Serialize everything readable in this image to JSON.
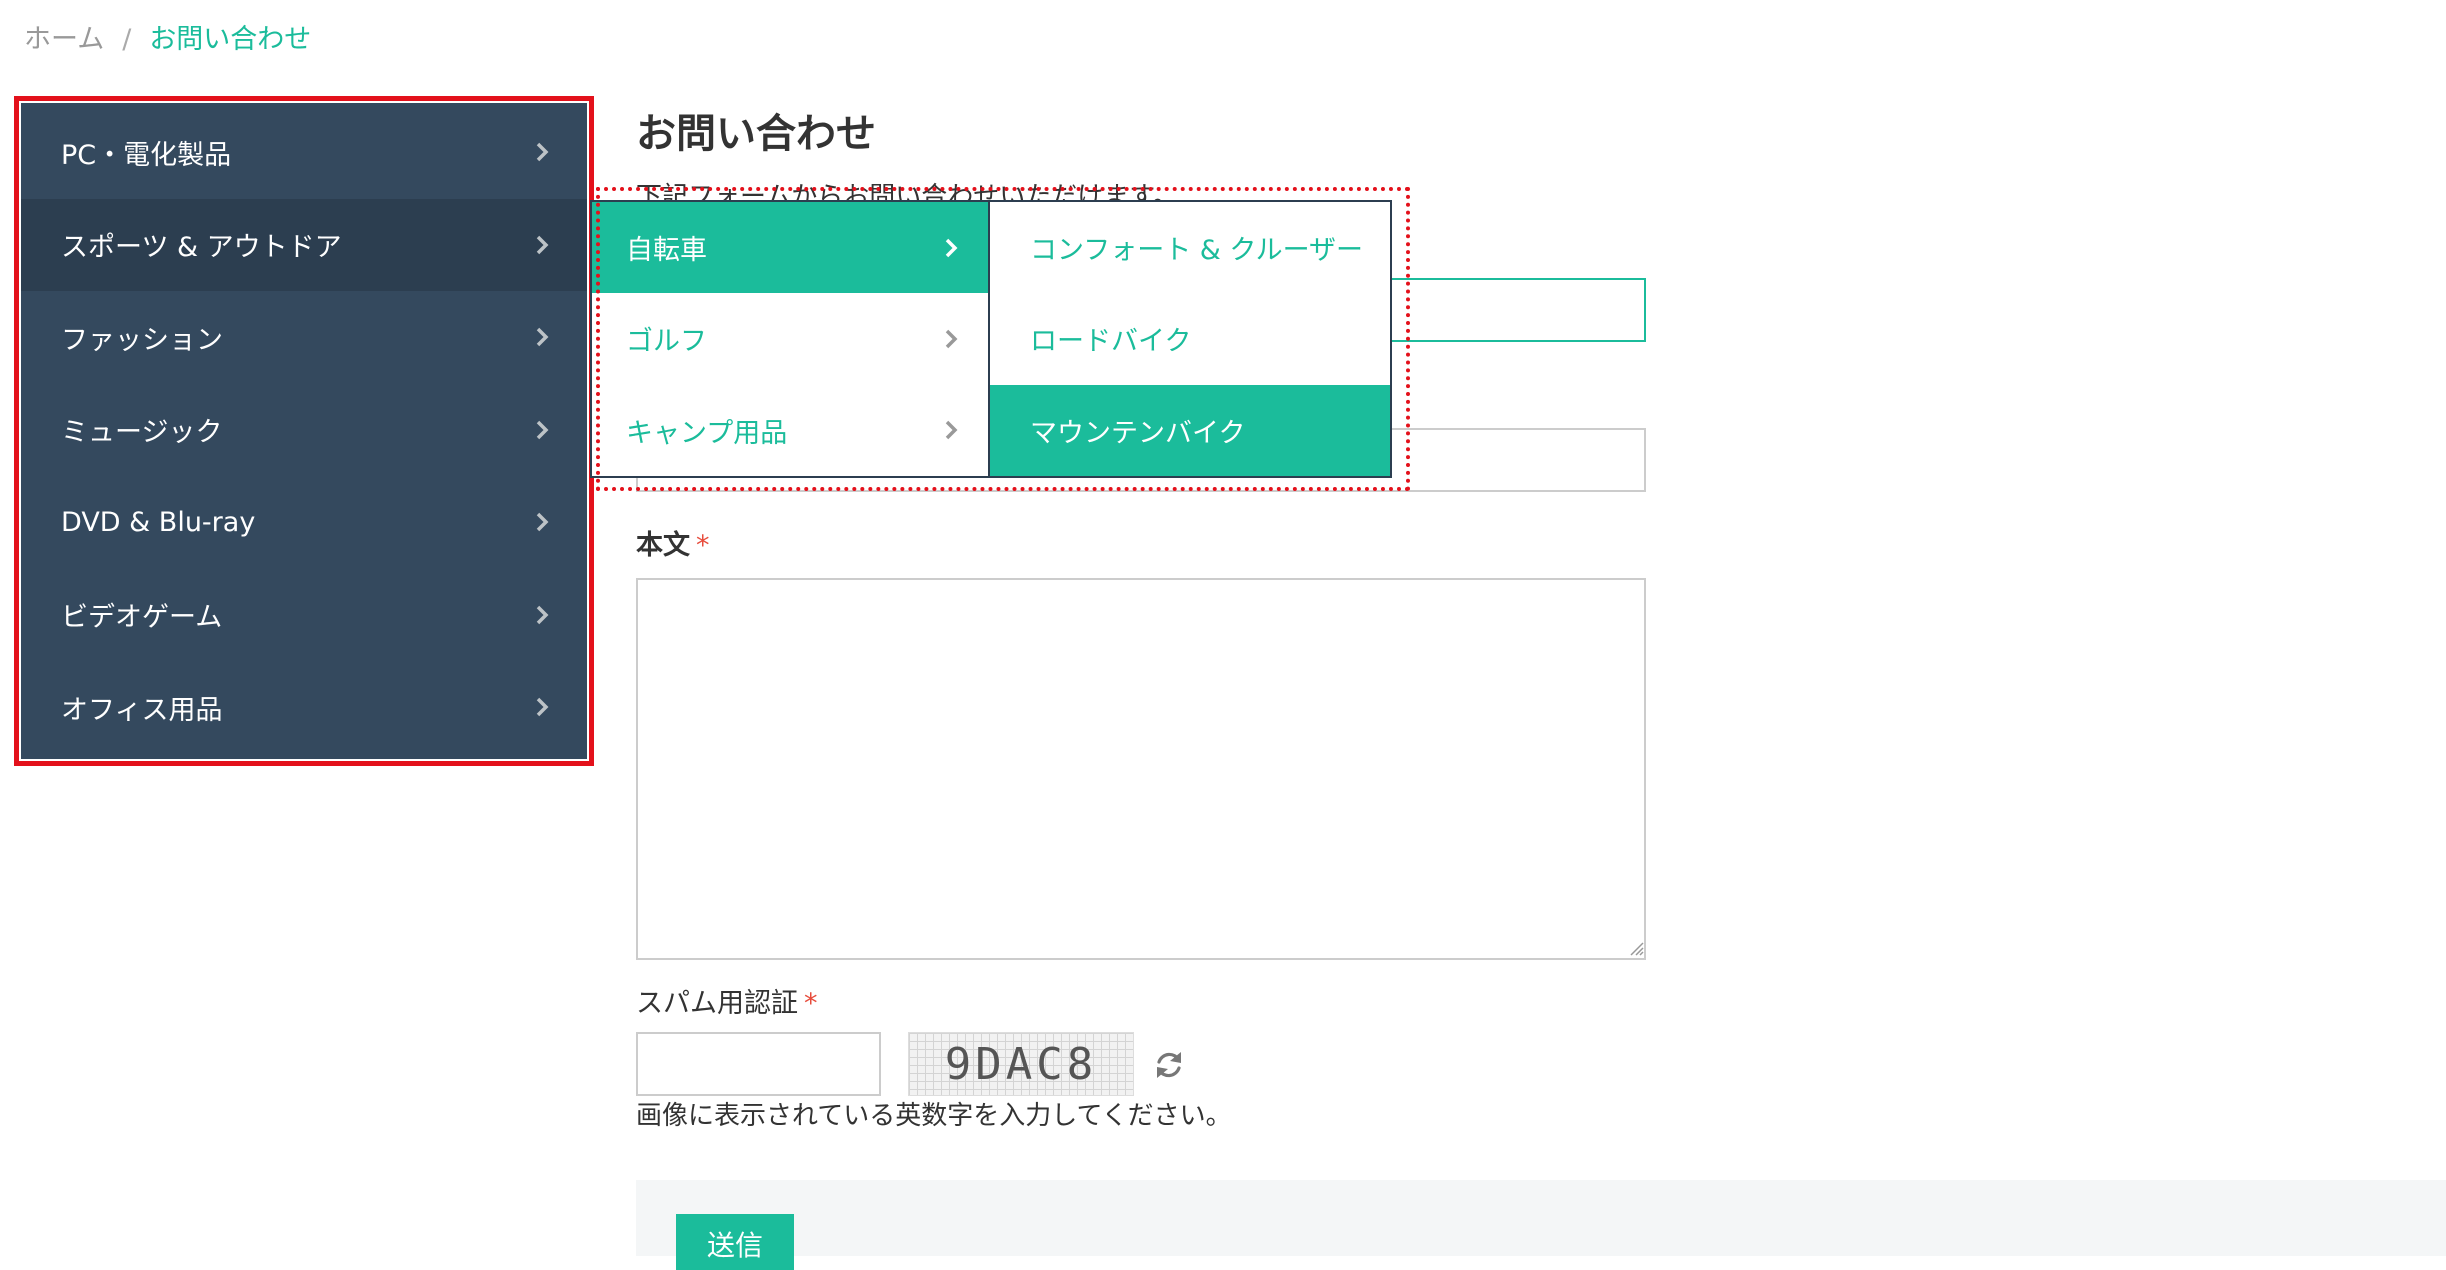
{
  "breadcrumb": {
    "home": "ホーム",
    "separator": "/",
    "current": "お問い合わせ"
  },
  "sidebar": {
    "items": [
      {
        "label": "PC・電化製品"
      },
      {
        "label": "スポーツ & アウトドア"
      },
      {
        "label": "ファッション"
      },
      {
        "label": "ミュージック"
      },
      {
        "label": "DVD & Blu-ray"
      },
      {
        "label": "ビデオゲーム"
      },
      {
        "label": "オフィス用品"
      }
    ]
  },
  "submenu": {
    "items": [
      {
        "label": "自転車"
      },
      {
        "label": "ゴルフ"
      },
      {
        "label": "キャンプ用品"
      }
    ]
  },
  "subsubmenu": {
    "items": [
      {
        "label": "コンフォート & クルーザー"
      },
      {
        "label": "ロードバイク"
      },
      {
        "label": "マウンテンバイク"
      }
    ]
  },
  "main": {
    "title": "お問い合わせ",
    "intro": "下記フォームからお問い合わせいただけます。",
    "body_label": "本文",
    "required_mark": "*",
    "spam_label": "スパム用認証",
    "captcha_text": "9DAC8",
    "captcha_help": "画像に表示されている英数字を入力してください。",
    "submit_label": "送信"
  },
  "colors": {
    "accent": "#1bbc9b",
    "sidebar_bg": "#34495e",
    "sidebar_active": "#2c3e50",
    "highlight_outline": "#e3111b"
  }
}
